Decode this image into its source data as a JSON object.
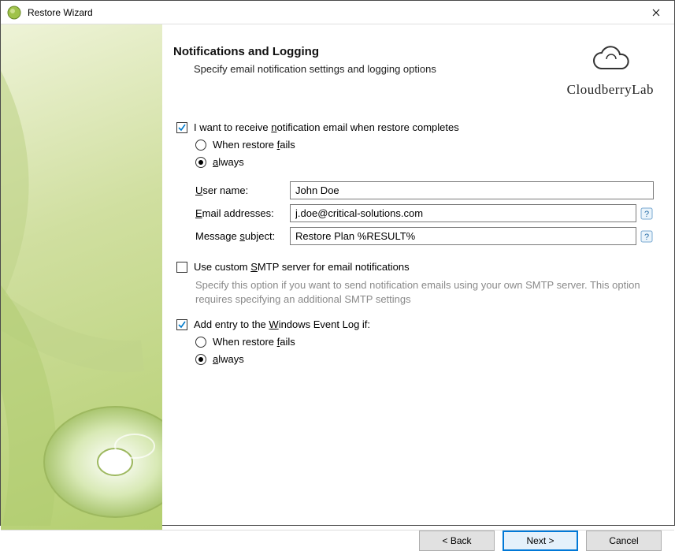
{
  "window": {
    "title": "Restore Wizard"
  },
  "brand": {
    "name": "CloudberryLab"
  },
  "header": {
    "title": "Notifications and Logging",
    "subtitle": "Specify email notification settings and logging options"
  },
  "notify": {
    "checkbox_prefix": "I want to receive ",
    "checkbox_u": "n",
    "checkbox_suffix": "otification email when restore completes",
    "fails_prefix": "When restore ",
    "fails_u": "f",
    "fails_suffix": "ails",
    "always_u": "a",
    "always_suffix": "lways",
    "user_prefix": "",
    "user_u": "U",
    "user_suffix": "ser name:",
    "email_u": "E",
    "email_suffix": "mail addresses:",
    "subject_prefix": "Message ",
    "subject_u": "s",
    "subject_suffix": "ubject:",
    "user_val": "John Doe",
    "email_val": "j.doe@critical-solutions.com",
    "subject_val": "Restore Plan %RESULT%"
  },
  "smtp": {
    "prefix": "Use custom ",
    "u": "S",
    "suffix": "MTP server for email notifications",
    "hint": "Specify this option if you want to send notification emails using your own SMTP server. This option requires specifying an additional SMTP settings"
  },
  "eventlog": {
    "prefix": "Add entry to the ",
    "u": "W",
    "suffix": "indows Event Log if:",
    "fails_prefix": "When restore ",
    "fails_u": "f",
    "fails_suffix": "ails",
    "always_u": "a",
    "always_suffix": "lways"
  },
  "buttons": {
    "back": "< Back",
    "next": "Next >",
    "cancel": "Cancel"
  }
}
